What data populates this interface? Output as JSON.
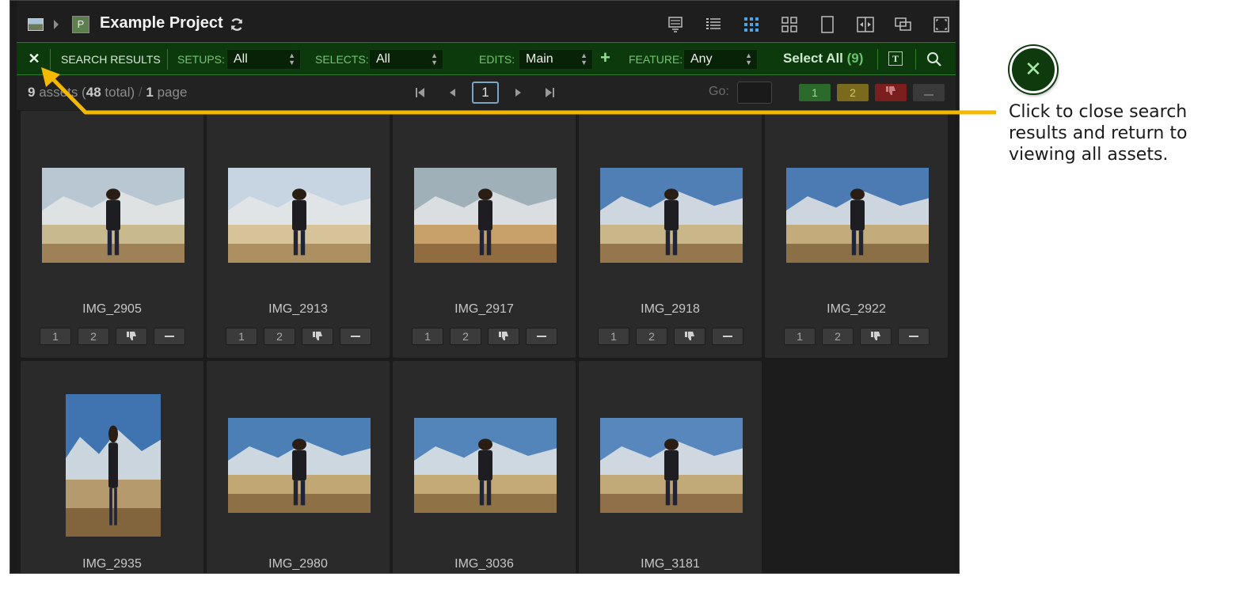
{
  "header": {
    "project_badge": "P",
    "title": "Example Project",
    "view_icons": [
      "timeline-view-icon",
      "list-view-icon",
      "small-grid-view-icon",
      "large-grid-view-icon",
      "single-view-icon",
      "compare-view-icon",
      "overlay-view-icon",
      "fullscreen-icon"
    ]
  },
  "filterbar": {
    "close_label": "✕",
    "search_results_label": "SEARCH RESULTS",
    "setups_label": "SETUPS:",
    "setups_value": "All",
    "selects_label": "SELECTS:",
    "selects_value": "All",
    "edits_label": "EDITS:",
    "edits_value": "Main",
    "add_label": "+",
    "feature_label": "FEATURE:",
    "feature_value": "Any",
    "select_all_label": "Select All",
    "select_all_count": "(9)",
    "text_toggle_label": "T",
    "accent_color": "#0d3a0d"
  },
  "pager": {
    "assets_count": "9",
    "assets_word": "assets (",
    "total_count": "48",
    "total_word": "total)",
    "separator": "/",
    "page_count": "1",
    "page_word": "page",
    "current_page": "1",
    "go_label": "Go:",
    "filter_buttons": [
      "1",
      "2",
      "thumbs-down-icon",
      "minus-icon"
    ]
  },
  "assets": [
    {
      "name": "IMG_2905"
    },
    {
      "name": "IMG_2913"
    },
    {
      "name": "IMG_2917"
    },
    {
      "name": "IMG_2918"
    },
    {
      "name": "IMG_2922"
    },
    {
      "name": "IMG_2935"
    },
    {
      "name": "IMG_2980"
    },
    {
      "name": "IMG_3036"
    },
    {
      "name": "IMG_3181"
    }
  ],
  "rating_labels": [
    "1",
    "2"
  ],
  "callout": {
    "icon_label": "✕",
    "text": "Click to close search results and return to viewing all assets.",
    "arrow_color": "#f5b800"
  }
}
